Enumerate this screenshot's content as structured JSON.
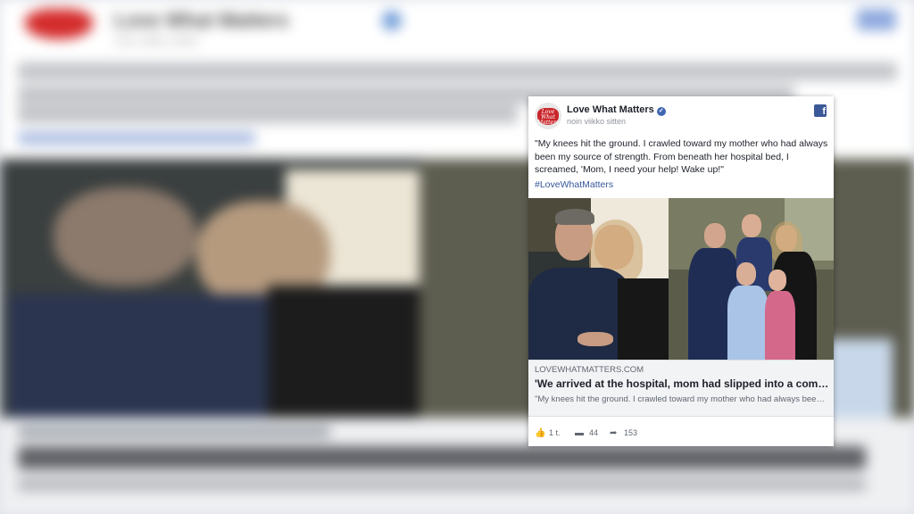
{
  "post": {
    "page_name": "Love What Matters",
    "avatar_text": "Love What Matters",
    "timestamp": "noin viikko sitten",
    "text": "\"My knees hit the ground. I crawled toward my mother who had always been my source of strength. From beneath her hospital bed, I screamed, 'Mom, I need your help! Wake up!\"",
    "hashtag": "#LoveWhatMatters"
  },
  "link": {
    "domain": "LOVEWHATMATTERS.COM",
    "title": "'We arrived at the hospital, mom had slipped into a coma. Her body was shutting down'",
    "description": "\"My knees hit the ground. I crawled toward my mother who had always been my source of strength."
  },
  "stats": {
    "likes": "1 t.",
    "comments": "44",
    "shares": "153"
  },
  "icons": {
    "verified": "verified-badge-icon",
    "facebook": "facebook-icon",
    "like": "thumbs-up-icon",
    "comment": "comment-icon",
    "share": "share-arrow-icon"
  },
  "colors": {
    "facebook_blue": "#3b5998",
    "link_blue": "#365899",
    "brand_red": "#c9262b"
  }
}
